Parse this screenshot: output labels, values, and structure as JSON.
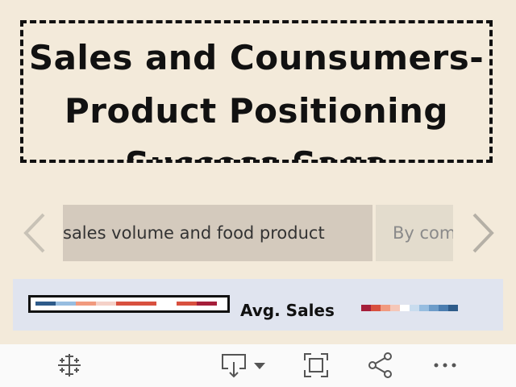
{
  "title": {
    "text": "Sales and Counsumers- Product Positioning Success Saga"
  },
  "story": {
    "prev_icon": "chevron-left-icon",
    "next_icon": "chevron-right-icon",
    "points": [
      {
        "label": "sales volume and food product",
        "active": true
      },
      {
        "label": "By com",
        "active": false
      }
    ]
  },
  "legend": {
    "label": "Avg. Sales",
    "swatch_colors": [
      "#2e5b8a",
      "#97bde0",
      "#f19a7f",
      "#f5d1c8",
      "#d8503f",
      "#d8503f",
      "#ffffff",
      "#d8503f",
      "#a51e3a"
    ],
    "scale_colors": [
      "#a51e3a",
      "#d8503f",
      "#f19a7f",
      "#f5c7b8",
      "#ffffff",
      "#c9dcee",
      "#97bde0",
      "#6d9cc9",
      "#4b7db0",
      "#2e5b8a"
    ]
  },
  "toolbar": {
    "items": [
      {
        "name": "tableau-logo-icon"
      },
      {
        "name": "download-icon"
      },
      {
        "name": "fullscreen-icon"
      },
      {
        "name": "share-icon"
      },
      {
        "name": "more-icon"
      }
    ]
  },
  "colors": {
    "background": "#f3eada",
    "story_active": "#d4cabd",
    "story_inactive": "#e3dccd",
    "legend_band": "#e0e4ef",
    "toolbar": "#fafafa"
  }
}
